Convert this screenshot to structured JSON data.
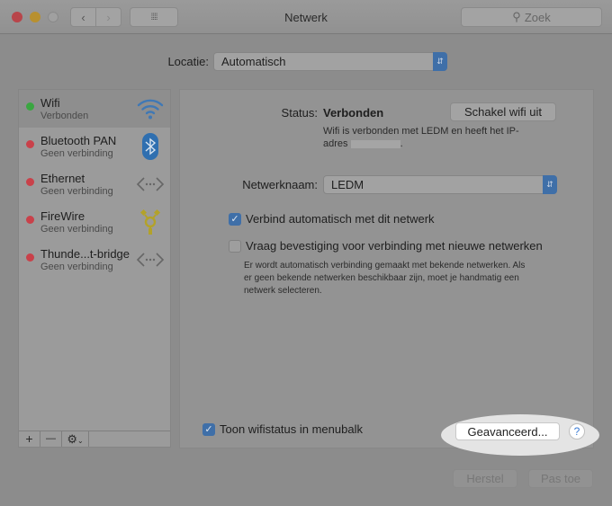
{
  "window": {
    "title": "Netwerk",
    "search_placeholder": "Zoek"
  },
  "location": {
    "label": "Locatie:",
    "value": "Automatisch"
  },
  "services": [
    {
      "name": "Wifi",
      "status": "Verbonden",
      "color": "#3aa640",
      "icon": "wifi-icon"
    },
    {
      "name": "Bluetooth PAN",
      "status": "Geen verbinding",
      "color": "#c9414a",
      "icon": "bluetooth-icon"
    },
    {
      "name": "Ethernet",
      "status": "Geen verbinding",
      "color": "#c9414a",
      "icon": "ethernet-icon"
    },
    {
      "name": "FireWire",
      "status": "Geen verbinding",
      "color": "#c9414a",
      "icon": "firewire-icon"
    },
    {
      "name": "Thunde...t-bridge",
      "status": "Geen verbinding",
      "color": "#c9414a",
      "icon": "thunderbolt-bridge-icon"
    }
  ],
  "sidebar_toolbar": {
    "add": "+",
    "remove": "—"
  },
  "detail": {
    "status_label": "Status:",
    "status_value": "Verbonden",
    "toggle_button": "Schakel wifi uit",
    "status_desc_1": "Wifi is verbonden met LEDM en heeft het IP-",
    "status_desc_2": "adres",
    "network_label": "Netwerknaam:",
    "network_value": "LEDM",
    "auto_connect": {
      "label": "Verbind automatisch met dit netwerk",
      "checked": true
    },
    "ask_join": {
      "label": "Vraag bevestiging voor verbinding met nieuwe netwerken",
      "checked": false
    },
    "ask_desc": [
      "Er wordt automatisch verbinding gemaakt met bekende netwerken. Als",
      "er geen bekende netwerken beschikbaar zijn, moet je handmatig een",
      "netwerk selecteren."
    ],
    "show_status": {
      "label": "Toon wifistatus in menubalk",
      "checked": true
    },
    "advanced_button": "Geavanceerd...",
    "help": "?"
  },
  "footer": {
    "revert": "Herstel",
    "apply": "Pas toe"
  }
}
